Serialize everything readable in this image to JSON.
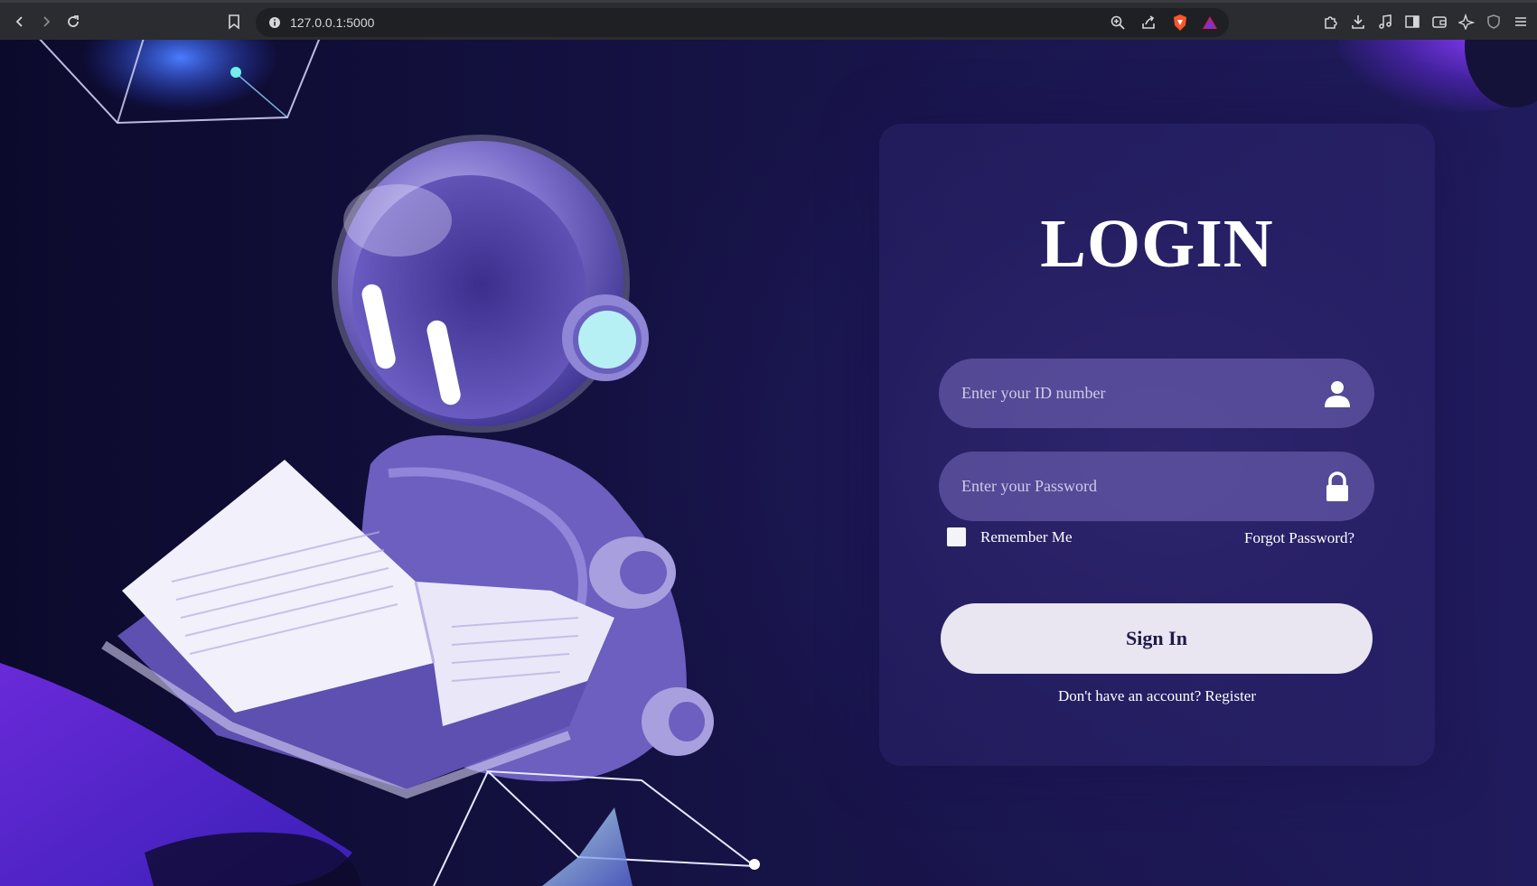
{
  "browser": {
    "url": "127.0.0.1:5000",
    "nav_icons": [
      "back-icon",
      "forward-icon",
      "reload-icon",
      "bookmark-icon",
      "site-info-icon"
    ],
    "address_icons": [
      "zoom-icon",
      "share-icon",
      "brave-shields-icon",
      "brave-rewards-icon"
    ],
    "toolbar_icons": [
      "extensions-icon",
      "download-icon",
      "media-icon",
      "sidebar-icon",
      "wallet-icon",
      "leo-ai-icon",
      "vpn-icon",
      "menu-icon"
    ]
  },
  "login": {
    "title": "LOGIN",
    "id_placeholder": "Enter your ID number",
    "password_placeholder": "Enter your Password",
    "remember_label": "Remember Me",
    "forgot_label": "Forgot Password?",
    "signin_label": "Sign In",
    "register_text": "Don't have an account?",
    "register_link": "Register"
  },
  "colors": {
    "page_bg": "#0d0b2e",
    "card_bg": "#2a2266",
    "field_bg": "#786cbe",
    "button_bg": "#e9e6f2",
    "button_text": "#1f1b4a"
  },
  "illustration": {
    "subject": "astronaut-reading-book-illustration"
  }
}
